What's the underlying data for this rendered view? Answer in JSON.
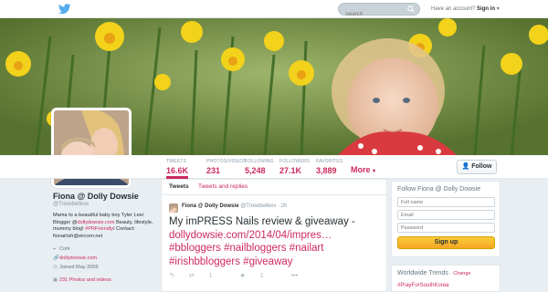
{
  "topbar": {
    "search_placeholder": "Search",
    "account_text": "Have an account?",
    "signin_label": "Sign in"
  },
  "stats": [
    {
      "label": "TWEETS",
      "value": "16.6K"
    },
    {
      "label": "PHOTOS/VIDEOS",
      "value": "231"
    },
    {
      "label": "FOLLOWING",
      "value": "5,248"
    },
    {
      "label": "FOLLOWERS",
      "value": "27.1K"
    },
    {
      "label": "FAVORITES",
      "value": "3,889"
    }
  ],
  "more_label": "More",
  "follow_label": "Follow",
  "profile": {
    "name": "Fiona @ Dolly Dowsie",
    "handle": "@Trixiebellexx",
    "bio_1": "Mama to a beautiful baby boy Tyler Lee/ Blogger @",
    "bio_link1": "dollydowsie.com",
    "bio_2": " Beauty, lifestyle, mummy blog! ",
    "bio_link2": "#PRFriendly",
    "bio_3": "/ Contact: fionairish@eircom.net",
    "location": "Cork",
    "website": "dollydowsie.com",
    "joined": "Joined May 2009",
    "photos_link": "231 Photos and videos"
  },
  "timeline": {
    "tab_tweets": "Tweets",
    "tab_replies": "Tweets and replies",
    "tweet": {
      "name": "Fiona @ Dolly Dowsie",
      "handle": "@Trixiebellexx · 2h",
      "text_plain": "My imPRESS Nails review & giveaway - ",
      "text_link": "dollydowsie.com/2014/04/impres…",
      "hashtags": "#bbloggers #nailbloggers #nailart #irishbbloggers #giveaway",
      "retweets": "1",
      "favorites": "1"
    }
  },
  "signup_box": {
    "title": "Follow Fiona @ Dolly Dowsie",
    "fullname_placeholder": "Full name",
    "email_placeholder": "Email",
    "password_placeholder": "Password",
    "signup_label": "Sign up"
  },
  "trends": {
    "title": "Worldwide Trends",
    "change_label": "· Change",
    "first": "#PrayForSouthKorea"
  },
  "colors": {
    "accent": "#cc2a5c",
    "twitter_blue": "#55acee",
    "signup_yellow": "#f5a623"
  }
}
